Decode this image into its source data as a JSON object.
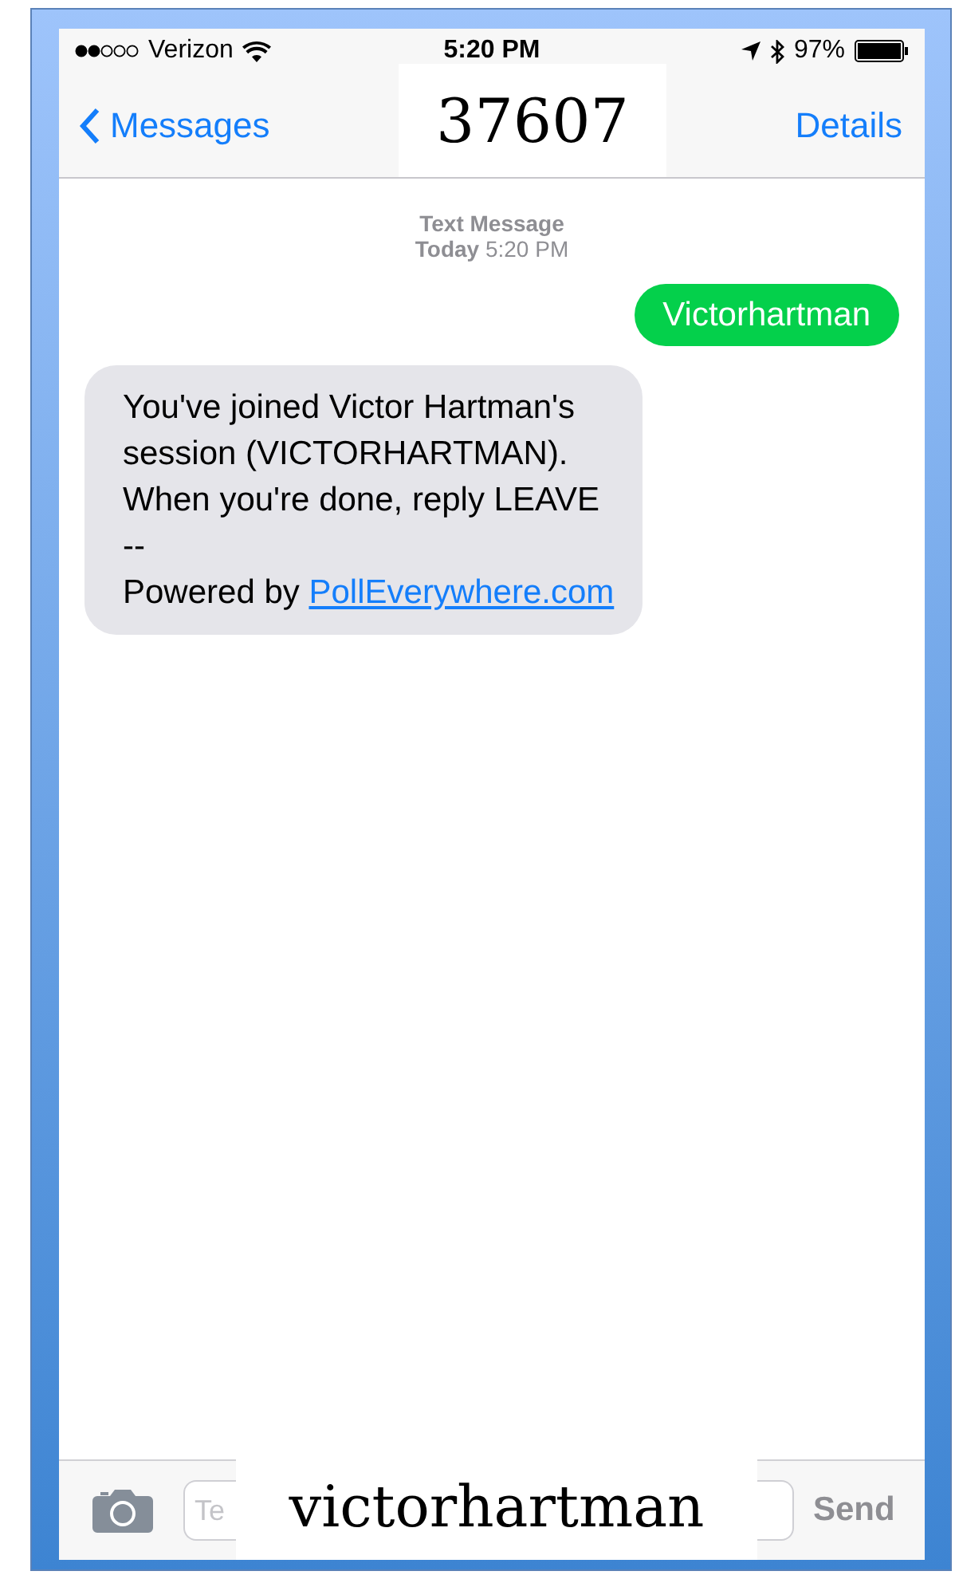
{
  "status_bar": {
    "carrier": "Verizon",
    "time": "5:20 PM",
    "battery": "97%"
  },
  "nav": {
    "back": "Messages",
    "title": "37607",
    "action": "Details"
  },
  "timestamp": {
    "label": "Text Message",
    "day": "Today",
    "time": "5:20 PM"
  },
  "messages": [
    {
      "kind": "sent",
      "text": "Victorhartman"
    },
    {
      "kind": "received",
      "text": "You've joined Victor Hartman's\nsession (VICTORHARTMAN).\nWhen you're done, reply LEAVE\n--\nPowered by ",
      "link": "PollEverywhere.com"
    }
  ],
  "composer": {
    "placeholder": "Te",
    "overlay_label": "victorhartman",
    "send": "Send",
    "send_disabled": true
  }
}
